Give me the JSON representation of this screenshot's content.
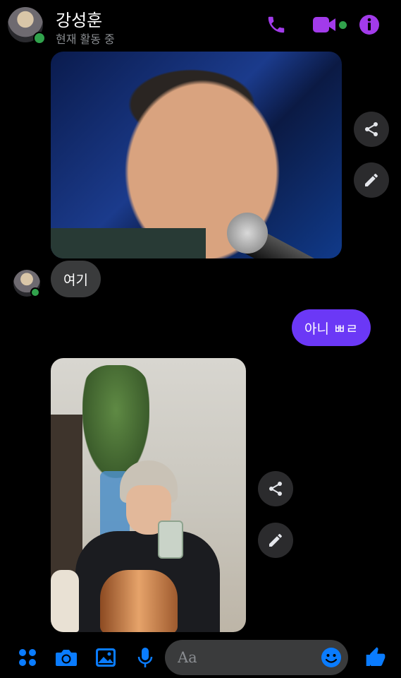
{
  "header": {
    "name": "강성훈",
    "status": "현재 활동 중",
    "accent_color": "#a23bea",
    "icons": [
      "phone-icon",
      "video-camera-icon",
      "info-icon"
    ]
  },
  "messages": [
    {
      "type": "image",
      "side": "incoming"
    },
    {
      "type": "text",
      "side": "incoming",
      "text": "여기"
    },
    {
      "type": "text",
      "side": "outgoing",
      "text": "아니 ㅃㄹ"
    },
    {
      "type": "image",
      "side": "incoming"
    }
  ],
  "actions": [
    "share-icon",
    "edit-icon"
  ],
  "composer": {
    "placeholder": "Aa",
    "icons": [
      "menu-dots-icon",
      "camera-icon",
      "gallery-icon",
      "microphone-icon",
      "emoji-icon",
      "thumbs-up-icon"
    ],
    "icon_color": "#0a7cff"
  },
  "colors": {
    "outgoing_bubble": "#6b38f6",
    "incoming_bubble": "#3a3b3c",
    "online": "#31a24c"
  }
}
